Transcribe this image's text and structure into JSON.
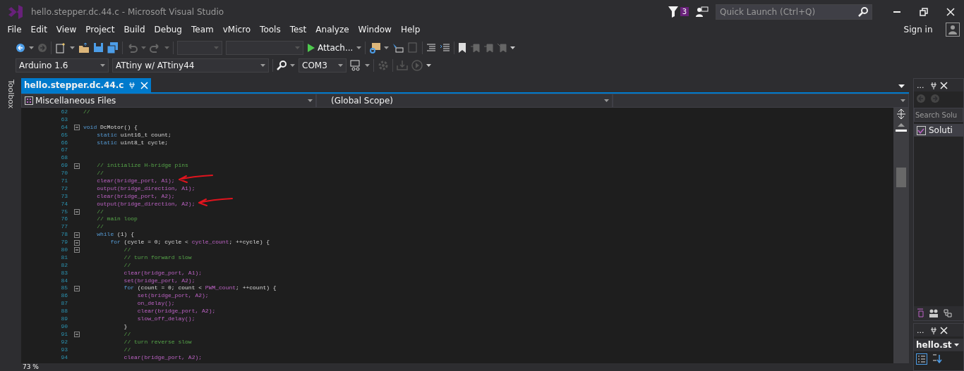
{
  "window": {
    "title": "hello.stepper.dc.44.c - Microsoft Visual Studio"
  },
  "notifications": {
    "count": "3"
  },
  "quick_launch": {
    "placeholder": "Quick Launch (Ctrl+Q)"
  },
  "menu": [
    "File",
    "Edit",
    "View",
    "Project",
    "Build",
    "Debug",
    "Team",
    "vMicro",
    "Tools",
    "Test",
    "Analyze",
    "Window",
    "Help"
  ],
  "account": {
    "label": "Sign in"
  },
  "toolbar": {
    "attach": "Attach..."
  },
  "vmicro_toolbar": {
    "board": "Arduino 1.6",
    "processor": "ATtiny w/ ATtiny44",
    "port": "COM3"
  },
  "toolbox": {
    "label": "Toolbox"
  },
  "tabs": [
    {
      "label": "hello.stepper.dc.44.c",
      "selected": true
    }
  ],
  "navigation": {
    "project": "Miscellaneous Files",
    "scope": "(Global Scope)"
  },
  "editor": {
    "lines": [
      {
        "number": "62",
        "fold": false,
        "marked": false,
        "tokens": [
          {
            "kind": "comment",
            "text": "//"
          }
        ]
      },
      {
        "number": "63",
        "fold": false,
        "marked": false
      },
      {
        "number": "64",
        "fold": true,
        "marked": false,
        "tokens": [
          {
            "kind": "keyword",
            "text": "void"
          },
          {
            "kind": "plain",
            "text": " DcMotor() {"
          }
        ]
      },
      {
        "number": "65",
        "fold": false,
        "marked": false,
        "tokens": [
          {
            "kind": "keyword",
            "text": "    static"
          },
          {
            "kind": "plain",
            "text": " uint16_t count;"
          }
        ]
      },
      {
        "number": "66",
        "fold": false,
        "marked": false,
        "tokens": [
          {
            "kind": "keyword",
            "text": "    static"
          },
          {
            "kind": "plain",
            "text": " uint8_t cycle;"
          }
        ]
      },
      {
        "number": "67",
        "fold": false,
        "marked": false
      },
      {
        "number": "68",
        "fold": false,
        "marked": false
      },
      {
        "number": "69",
        "fold": true,
        "marked": false,
        "tokens": [
          {
            "kind": "comment",
            "text": "    // initialize H-bridge pins"
          }
        ]
      },
      {
        "number": "70",
        "fold": false,
        "marked": false,
        "tokens": [
          {
            "kind": "comment",
            "text": "    //"
          }
        ]
      },
      {
        "number": "71",
        "fold": false,
        "marked": true,
        "tokens": [
          {
            "kind": "macro",
            "text": "    clear(bridge_port, A1);"
          }
        ]
      },
      {
        "number": "72",
        "fold": false,
        "marked": false,
        "tokens": [
          {
            "kind": "macro",
            "text": "    output(bridge_direction, A1);"
          }
        ]
      },
      {
        "number": "73",
        "fold": false,
        "marked": false,
        "tokens": [
          {
            "kind": "macro",
            "text": "    clear(bridge_port, A2);"
          }
        ]
      },
      {
        "number": "74",
        "fold": false,
        "marked": true,
        "tokens": [
          {
            "kind": "macro",
            "text": "    output(bridge_direction, A2);"
          }
        ]
      },
      {
        "number": "75",
        "fold": true,
        "marked": false,
        "tokens": [
          {
            "kind": "comment",
            "text": "    //"
          }
        ]
      },
      {
        "number": "76",
        "fold": false,
        "marked": false,
        "tokens": [
          {
            "kind": "comment",
            "text": "    // main loop"
          }
        ]
      },
      {
        "number": "77",
        "fold": false,
        "marked": false,
        "tokens": [
          {
            "kind": "comment",
            "text": "    //"
          }
        ]
      },
      {
        "number": "78",
        "fold": true,
        "marked": false,
        "tokens": [
          {
            "kind": "keyword",
            "text": "    while"
          },
          {
            "kind": "plain",
            "text": " (1) {"
          }
        ]
      },
      {
        "number": "79",
        "fold": true,
        "marked": false,
        "tokens": [
          {
            "kind": "keyword",
            "text": "        for"
          },
          {
            "kind": "plain",
            "text": " (cycle = 0; cycle < "
          },
          {
            "kind": "macro",
            "text": "cycle_count"
          },
          {
            "kind": "plain",
            "text": "; ++cycle) {"
          }
        ]
      },
      {
        "number": "80",
        "fold": true,
        "marked": false,
        "tokens": [
          {
            "kind": "comment",
            "text": "            //"
          }
        ]
      },
      {
        "number": "81",
        "fold": false,
        "marked": false,
        "tokens": [
          {
            "kind": "comment",
            "text": "            // turn forward slow"
          }
        ]
      },
      {
        "number": "82",
        "fold": false,
        "marked": false,
        "tokens": [
          {
            "kind": "comment",
            "text": "            //"
          }
        ]
      },
      {
        "number": "83",
        "fold": false,
        "marked": false,
        "tokens": [
          {
            "kind": "macro",
            "text": "            clear(bridge_port, A1);"
          }
        ]
      },
      {
        "number": "84",
        "fold": false,
        "marked": false,
        "tokens": [
          {
            "kind": "macro",
            "text": "            set(bridge_port, A2);"
          }
        ]
      },
      {
        "number": "85",
        "fold": true,
        "marked": false,
        "tokens": [
          {
            "kind": "keyword",
            "text": "            for"
          },
          {
            "kind": "plain",
            "text": " (count = 0; count < "
          },
          {
            "kind": "macro",
            "text": "PWM_count"
          },
          {
            "kind": "plain",
            "text": "; ++count) {"
          }
        ]
      },
      {
        "number": "86",
        "fold": false,
        "marked": false,
        "tokens": [
          {
            "kind": "macro",
            "text": "                set(bridge_port, A2);"
          }
        ]
      },
      {
        "number": "87",
        "fold": false,
        "marked": false,
        "tokens": [
          {
            "kind": "macro",
            "text": "                on_delay();"
          }
        ]
      },
      {
        "number": "88",
        "fold": false,
        "marked": false,
        "tokens": [
          {
            "kind": "macro",
            "text": "                clear(bridge_port, A2);"
          }
        ]
      },
      {
        "number": "89",
        "fold": false,
        "marked": false,
        "tokens": [
          {
            "kind": "macro",
            "text": "                slow_off_delay();"
          }
        ]
      },
      {
        "number": "90",
        "fold": false,
        "marked": false,
        "tokens": [
          {
            "kind": "plain",
            "text": "            }"
          }
        ]
      },
      {
        "number": "91",
        "fold": true,
        "marked": false,
        "tokens": [
          {
            "kind": "comment",
            "text": "            //"
          }
        ]
      },
      {
        "number": "92",
        "fold": false,
        "marked": false,
        "tokens": [
          {
            "kind": "comment",
            "text": "            // turn reverse slow"
          }
        ]
      },
      {
        "number": "93",
        "fold": false,
        "marked": false,
        "tokens": [
          {
            "kind": "comment",
            "text": "            //"
          }
        ]
      },
      {
        "number": "94",
        "fold": false,
        "marked": false,
        "tokens": [
          {
            "kind": "macro",
            "text": "            clear(bridge_port, A2);"
          }
        ]
      }
    ]
  },
  "zoom": "73 %",
  "solution_explorer": {
    "menu": "...",
    "search_placeholder": "Search Solu",
    "items": [
      {
        "label": "Soluti",
        "selected": true
      }
    ]
  },
  "properties": {
    "menu": "...",
    "object": "hello.st"
  }
}
